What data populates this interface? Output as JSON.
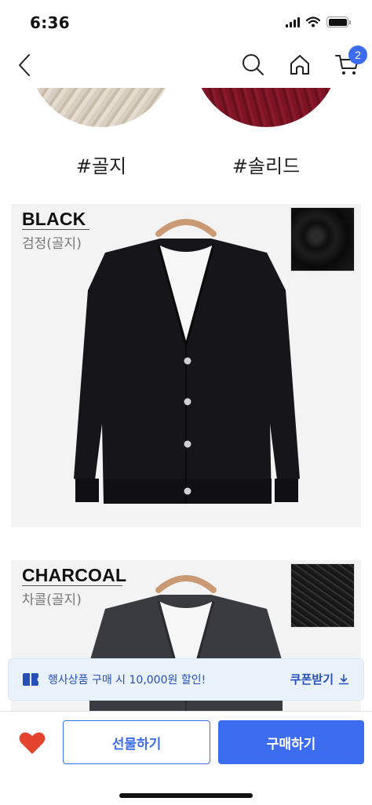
{
  "status_bar": {
    "time": "6:36"
  },
  "nav": {
    "back_icon": "chevron-left-icon",
    "search_icon": "search-icon",
    "home_icon": "home-icon",
    "cart_icon": "cart-icon",
    "cart_count": "2",
    "accent_color": "#3c6cf0"
  },
  "texture_tags": [
    {
      "label": "#골지"
    },
    {
      "label": "#솔리드"
    }
  ],
  "colors": [
    {
      "name": "BLACK",
      "name_ko": "검정(골지)"
    },
    {
      "name": "CHARCOAL",
      "name_ko": "차콜(골지)"
    }
  ],
  "coupon": {
    "text": "행사상품 구매 시 10,000원 할인!",
    "link_label": "쿠폰받기",
    "link_icon": "download-icon",
    "banner_icon": "coupon-icon"
  },
  "bottom_bar": {
    "wish_icon": "heart-icon",
    "gift_label": "선물하기",
    "buy_label": "구매하기"
  }
}
